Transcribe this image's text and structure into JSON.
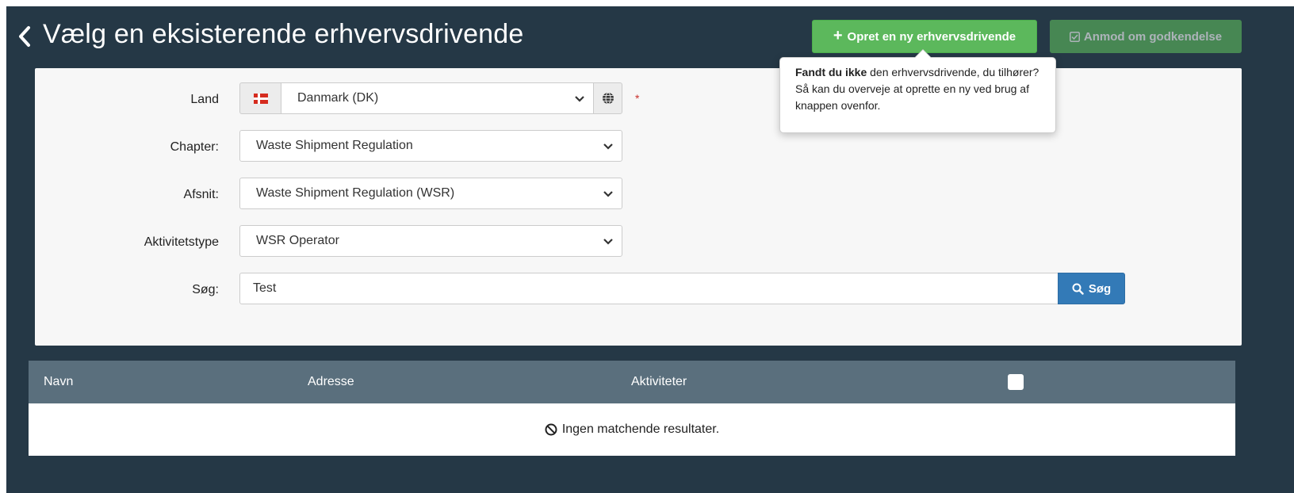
{
  "header": {
    "title": "Vælg en eksisterende erhvervsdrivende",
    "create_button": "Opret en ny erhvervsdrivende",
    "request_button": "Anmod om godkendelse"
  },
  "popover": {
    "bold_text": "Fandt du ikke",
    "text": " den erhvervsdrivende, du tilhører? Så kan du overveje at oprette en ny ved brug af knappen ovenfor."
  },
  "form": {
    "land_label": "Land",
    "land_value": "Danmark (DK)",
    "land_required_marker": "*",
    "chapter_label": "Chapter:",
    "chapter_value": "Waste Shipment Regulation",
    "afsnit_label": "Afsnit:",
    "afsnit_value": "Waste Shipment Regulation (WSR)",
    "aktivitetstype_label": "Aktivitetstype",
    "aktivitetstype_value": "WSR Operator",
    "search_label": "Søg:",
    "search_value": "Test",
    "search_button": "Søg"
  },
  "results": {
    "columns": [
      "Navn",
      "Adresse",
      "Aktiviteter"
    ],
    "empty_message": "Ingen matchende resultater."
  },
  "colors": {
    "background": "#253846",
    "panel": "#f7f7f7",
    "primary_green": "#5cb85c",
    "search_blue": "#337ab7",
    "table_header": "#5a6f7d"
  },
  "icons": {
    "back": "chevron-left-icon",
    "plus": "plus-icon",
    "check": "check-square-icon",
    "flag": "denmark-flag-icon",
    "globe": "globe-icon",
    "search": "search-icon",
    "no_results": "ban-icon"
  }
}
